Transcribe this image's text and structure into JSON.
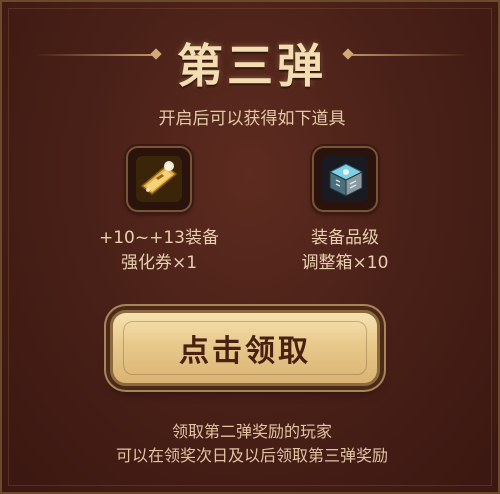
{
  "header": {
    "title": "第三弹",
    "subtitle": "开启后可以获得如下道具"
  },
  "items": [
    {
      "icon": "enhancement-ticket-icon",
      "line1": "+10~+13装备",
      "line2": "强化券×1"
    },
    {
      "icon": "equipment-grade-box-icon",
      "line1": "装备品级",
      "line2": "调整箱×10"
    }
  ],
  "claim_button": {
    "label": "点击领取"
  },
  "footer": {
    "line1": "领取第二弹奖励的玩家",
    "line2": "可以在领奖次日及以后领取第三弹奖励"
  },
  "colors": {
    "background": "#4a2118",
    "title": "#f3deb2",
    "button": "#e8c98c",
    "button_text": "#4a2110"
  }
}
